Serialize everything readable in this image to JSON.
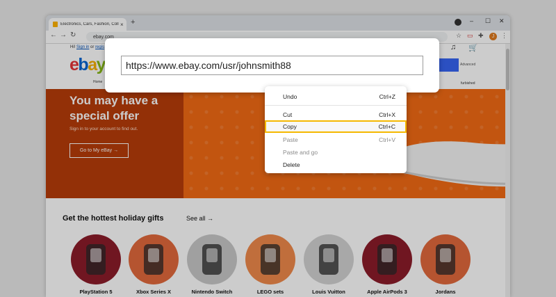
{
  "browser": {
    "tab_title": "Electronics, Cars, Fashion, Collec",
    "tab_close": "×",
    "new_tab": "+",
    "window_buttons": [
      "–",
      "☐",
      "✕"
    ],
    "address": "ebay.com",
    "profile_initial": "J"
  },
  "page": {
    "greeting_prefix": "Hi!",
    "sign_in": "Sign in",
    "or": "or",
    "register": "regis",
    "logo": {
      "e": "e",
      "b": "b",
      "a": "a",
      "y": "y"
    },
    "advanced": "Advanced",
    "home_nav": "Home",
    "refurbished": "furbished",
    "hero": {
      "title": "You may have a special offer",
      "subtitle": "Sign in to your account to find out.",
      "button": "Go to My eBay",
      "button_arrow": "→"
    },
    "hot_title": "Get the hottest holiday gifts",
    "see_all": "See all",
    "see_all_arrow": "→",
    "products": [
      {
        "label": "PlayStation 5",
        "bg": "#8c1c2a"
      },
      {
        "label": "Xbox Series X",
        "bg": "#e36a3c"
      },
      {
        "label": "Nintendo Switch",
        "bg": "#c9c9c9"
      },
      {
        "label": "LEGO sets",
        "bg": "#f08a4b"
      },
      {
        "label": "Louis Vuitton",
        "bg": "#d3d3d3"
      },
      {
        "label": "Apple AirPods 3",
        "bg": "#8c1c2a"
      },
      {
        "label": "Jordans",
        "bg": "#e36a3c"
      }
    ]
  },
  "popup": {
    "url": "https://www.ebay.com/usr/johnsmith88"
  },
  "context_menu": {
    "undo": {
      "label": "Undo",
      "key": "Ctrl+Z"
    },
    "cut": {
      "label": "Cut",
      "key": "Ctrl+X"
    },
    "copy": {
      "label": "Copy",
      "key": "Ctrl+C"
    },
    "paste": {
      "label": "Paste",
      "key": "Ctrl+V"
    },
    "paste_and_go": {
      "label": "Paste and go"
    },
    "delete": {
      "label": "Delete"
    },
    "highlight_color": "#f5b800"
  }
}
